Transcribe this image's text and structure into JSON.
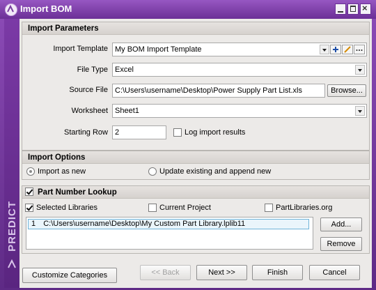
{
  "window": {
    "title": "Import BOM"
  },
  "brand": {
    "name": "PREDICT"
  },
  "import_parameters": {
    "header": "Import Parameters",
    "template_label": "Import Template",
    "template_value": "My BOM Import Template",
    "file_type_label": "File Type",
    "file_type_value": "Excel",
    "source_file_label": "Source File",
    "source_file_value": "C:\\Users\\username\\Desktop\\Power Supply Part List.xls",
    "browse_label": "Browse...",
    "worksheet_label": "Worksheet",
    "worksheet_value": "Sheet1",
    "starting_row_label": "Starting Row",
    "starting_row_value": "2",
    "log_label": "Log import results"
  },
  "import_options": {
    "header": "Import Options",
    "import_new": "Import as new",
    "update_existing": "Update existing and append new"
  },
  "part_lookup": {
    "header": "Part Number Lookup",
    "selected_libraries": "Selected Libraries",
    "current_project": "Current Project",
    "partlibraries": "PartLibraries.org",
    "libraries": [
      {
        "index": "1",
        "path": "C:\\Users\\username\\Desktop\\My Custom Part Library.lplib11"
      }
    ],
    "add_label": "Add...",
    "remove_label": "Remove"
  },
  "footer": {
    "customize": "Customize Categories",
    "back": "<< Back",
    "next": "Next >>",
    "finish": "Finish",
    "cancel": "Cancel"
  }
}
